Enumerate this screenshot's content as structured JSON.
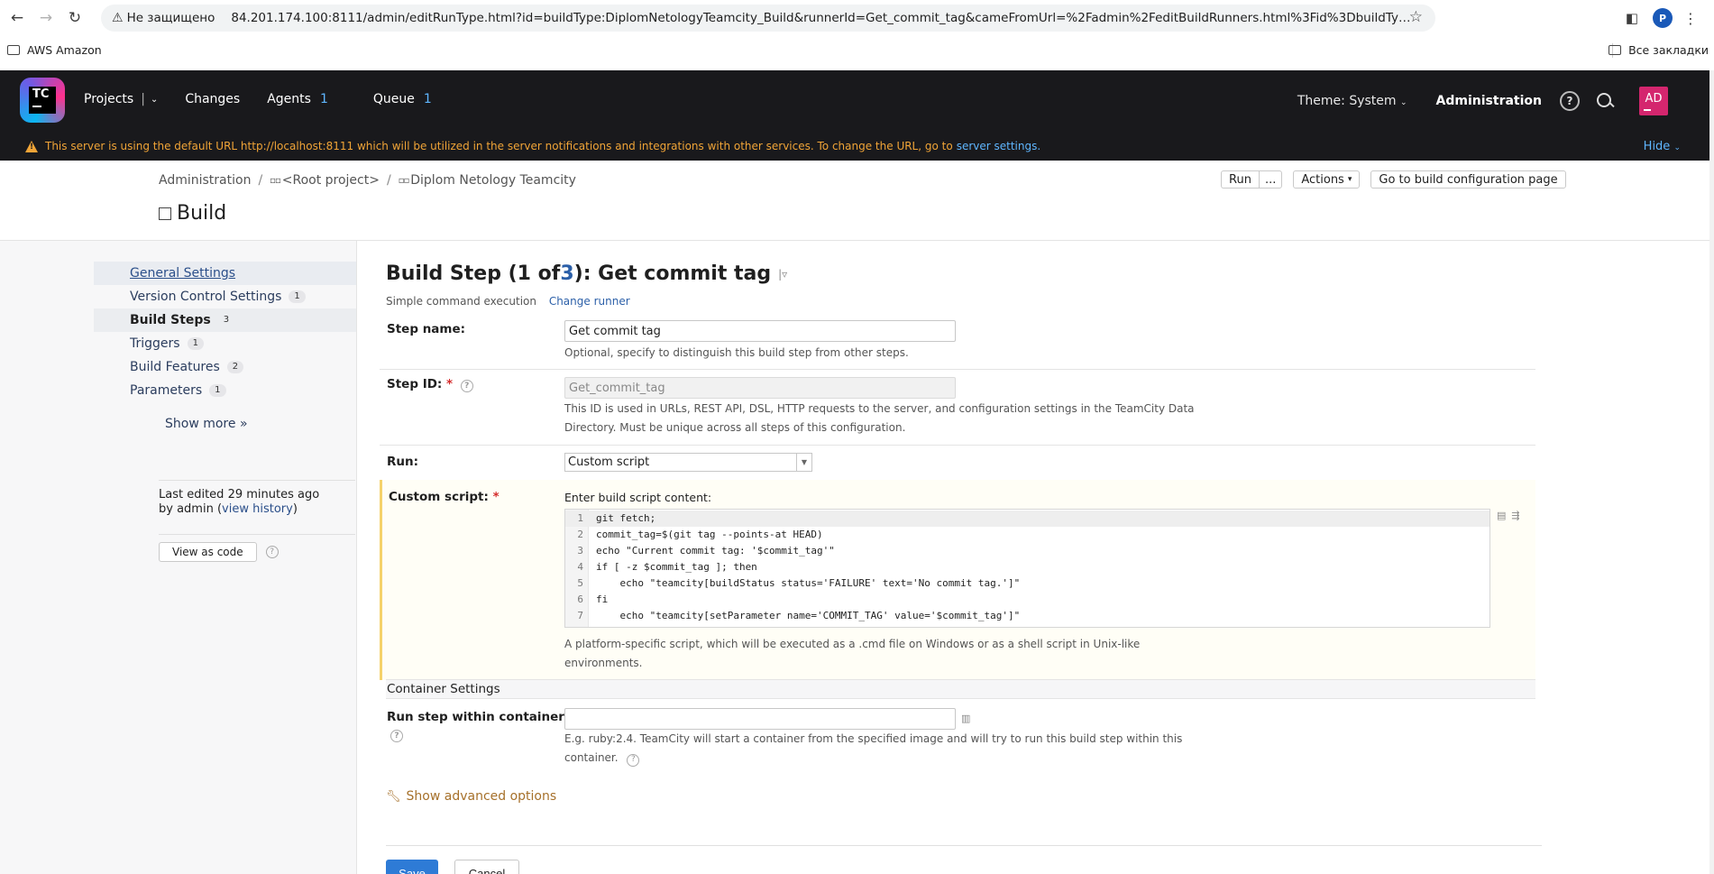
{
  "browser": {
    "security_label": "Не защищено",
    "url": "84.201.174.100:8111/admin/editRunType.html?id=buildType:DiplomNetologyTeamcity_Build&runnerId=Get_commit_tag&cameFromUrl=%2Fadmin%2FeditBuildRunners.html%3Fid%3DbuildType%253ADiplomNet...",
    "profile_initial": "P",
    "bookmark_left": "AWS Amazon",
    "bookmark_right": "Все закладки"
  },
  "header": {
    "logo_text": "TC",
    "nav": [
      {
        "label": "Projects",
        "count": ""
      },
      {
        "label": "Changes",
        "count": ""
      },
      {
        "label": "Agents",
        "count": "1"
      },
      {
        "label": "Queue",
        "count": "1"
      }
    ],
    "theme_label": "Theme: System",
    "admin_label": "Administration",
    "help_icon": "?",
    "avatar_initials": "AD"
  },
  "banner": {
    "text": "This server is using the default URL http://localhost:8111 which will be utilized in the server notifications and integrations with other services. To change the URL, go to",
    "link": "server settings.",
    "hide": "Hide"
  },
  "page": {
    "breadcrumb": [
      "Administration",
      "<Root project>",
      "Diplom Netology Teamcity"
    ],
    "title": "Build",
    "run_label": "Run",
    "run_more": "...",
    "actions_label": "Actions",
    "goto_label": "Go to build configuration page"
  },
  "sidebar": {
    "items": [
      {
        "label": "General Settings",
        "badge": ""
      },
      {
        "label": "Version Control Settings",
        "badge": "1"
      },
      {
        "label": "Build Steps",
        "badge": "3"
      },
      {
        "label": "Triggers",
        "badge": "1"
      },
      {
        "label": "Build Features",
        "badge": "2"
      },
      {
        "label": "Parameters",
        "badge": "1"
      }
    ],
    "show_more": "Show more »",
    "last_edited_prefix": "Last edited",
    "last_edited_time": "29 minutes ago",
    "by_prefix": "by admin",
    "view_history": "view history",
    "view_as_code": "View as code"
  },
  "step": {
    "title_prefix": "Build Step (1 of ",
    "title_count": "3",
    "title_suffix": "): Get commit tag",
    "runner_desc": "Simple command execution",
    "change_runner": "Change runner",
    "step_name_label": "Step name:",
    "step_name_value": "Get commit tag",
    "step_name_hint": "Optional, specify to distinguish this build step from other steps.",
    "step_id_label": "Step ID:",
    "step_id_value": "Get_commit_tag",
    "step_id_hint_1": "This ID is used in URLs, REST API, DSL, HTTP requests to the server, and configuration settings in the TeamCity Data",
    "step_id_hint_2": "Directory. Must be unique across all steps of this configuration.",
    "run_label": "Run:",
    "run_value": "Custom script",
    "custom_script_label": "Custom script:",
    "script_prompt": "Enter build script content:",
    "code_lines": [
      "git fetch;",
      "commit_tag=$(git tag --points-at HEAD)",
      "echo \"Current commit tag: '$commit_tag'\"",
      "if [ -z $commit_tag ]; then",
      "    echo \"teamcity[buildStatus status='FAILURE' text='No commit tag.']\"",
      "fi",
      "    echo \"teamcity[setParameter name='COMMIT_TAG' value='$commit_tag']\""
    ],
    "script_hint_1": "A platform-specific script, which will be executed as a .cmd file on Windows or as a shell script in Unix-like",
    "script_hint_2": "environments.",
    "container_section": "Container Settings",
    "container_label": "Run step within container:",
    "container_value": "",
    "container_hint_1": "E.g. ruby:2.4. TeamCity will start a container from the specified image and will try to run this build step within this",
    "container_hint_2": "container.",
    "advanced": "Show advanced options",
    "save": "Save",
    "cancel": "Cancel"
  }
}
